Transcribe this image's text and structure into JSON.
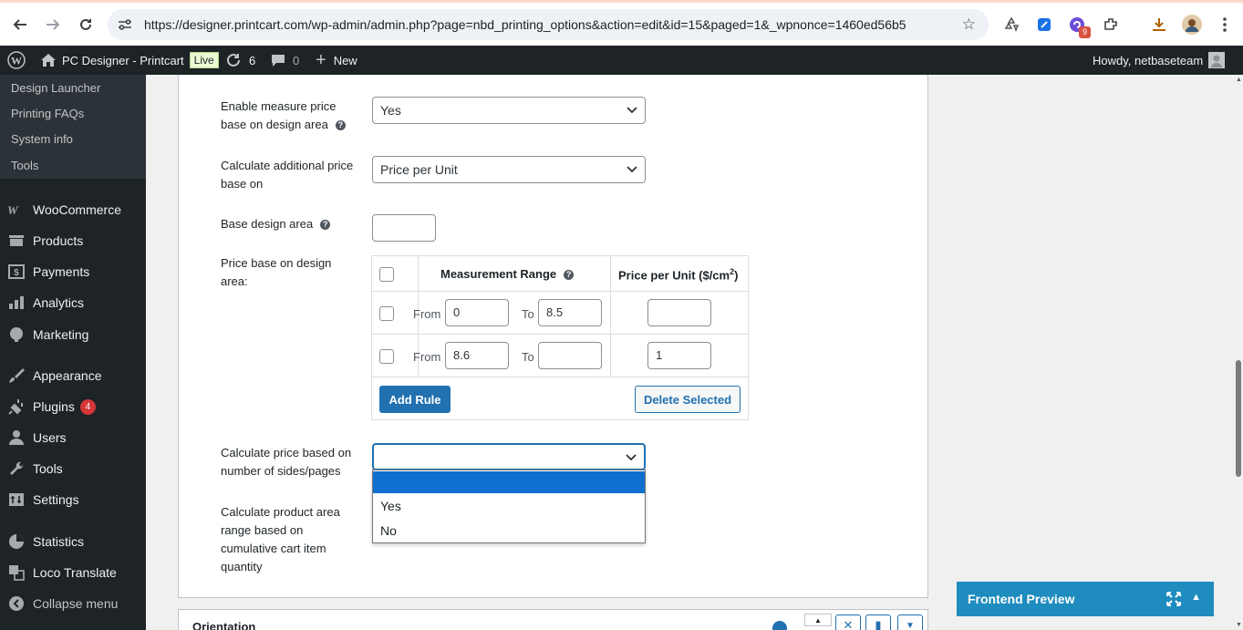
{
  "browser": {
    "url": "https://designer.printcart.com/wp-admin/admin.php?page=nbd_printing_options&action=edit&id=15&paged=1&_wpnonce=1460ed56b5",
    "ext_badge": "9"
  },
  "adminbar": {
    "site_name": "PC Designer - Printcart",
    "live_label": "Live",
    "updates_count": "6",
    "comments_count": "0",
    "new_label": "New",
    "howdy": "Howdy, netbaseteam"
  },
  "sidebar": {
    "submenu": [
      "Design Launcher",
      "Printing FAQs",
      "System info",
      "Tools"
    ],
    "woocommerce": "WooCommerce",
    "products": "Products",
    "payments": "Payments",
    "analytics": "Analytics",
    "marketing": "Marketing",
    "appearance": "Appearance",
    "plugins": "Plugins",
    "plugins_badge": "4",
    "users": "Users",
    "tools": "Tools",
    "settings": "Settings",
    "statistics": "Statistics",
    "loco": "Loco Translate",
    "collapse": "Collapse menu"
  },
  "form": {
    "measure_label_1": "Enable measure price",
    "measure_label_2": "base on design area",
    "measure_value": "Yes",
    "calc_label_1": "Calculate additional price",
    "calc_label_2": "base on",
    "calc_value": "Price per Unit",
    "base_area_label": "Base design area",
    "base_area_value": "",
    "price_area_label_1": "Price base on design",
    "price_area_label_2": "area:",
    "table": {
      "col_range": "Measurement Range",
      "col_price_prefix": "Price per Unit ($/cm",
      "col_price_sup": "2",
      "col_price_suffix": ")",
      "from_label": "From",
      "to_label": "To",
      "rows": [
        {
          "from": "0",
          "to": "8.5",
          "price": ""
        },
        {
          "from": "8.6",
          "to": "",
          "price": "1"
        }
      ],
      "add_rule": "Add Rule",
      "delete_selected": "Delete Selected"
    },
    "sides_label_1": "Calculate price based on",
    "sides_label_2": "number of sides/pages",
    "sides_value": "",
    "sides_options": [
      "",
      "Yes",
      "No"
    ],
    "cart_label_1": "Calculate product area",
    "cart_label_2": "range based on",
    "cart_label_3": "cumulative cart item",
    "cart_label_4": "quantity"
  },
  "orientation_title": "Orientation",
  "frontend_preview": "Frontend Preview"
}
